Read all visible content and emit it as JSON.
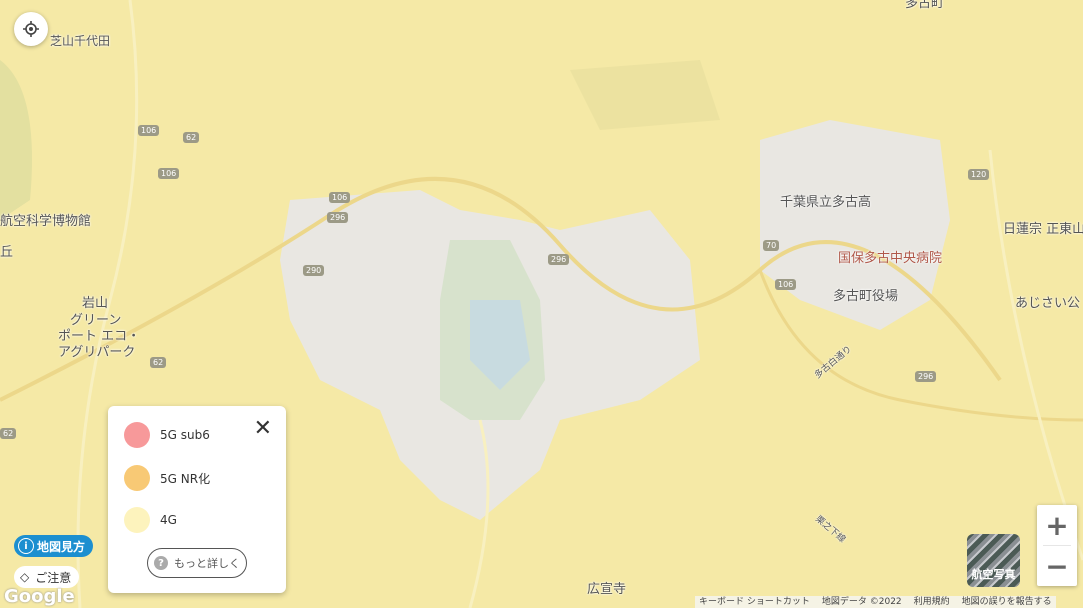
{
  "map": {
    "labels": {
      "top_town": "多古町",
      "shibayama": "芝山千代田",
      "museum": "航空科学博物館",
      "oka": "丘",
      "iwayama": "岩山",
      "green_port": "グリーン",
      "green_port2": "ポート エコ・",
      "green_port3": "アグリパーク",
      "high_school": "千葉県立多古高",
      "hospital": "国保多古中央病院",
      "town_office": "多古町役場",
      "temple_nichiren": "日蓮宗 正東山",
      "ajisai": "あじさい公",
      "kosenji": "広宣寺",
      "street_tako": "多古白通り",
      "street_kurinoshita": "栗之下線"
    },
    "shields": [
      "106",
      "62",
      "106",
      "106",
      "296",
      "290",
      "296",
      "70",
      "106",
      "120",
      "62",
      "296",
      "62"
    ]
  },
  "controls": {
    "locate_icon": "crosshair-icon"
  },
  "legend": {
    "items": [
      {
        "label": "5G sub6",
        "color": "#f7999a"
      },
      {
        "label": "5G NR化",
        "color": "#f8c975"
      },
      {
        "label": "4G",
        "color": "#fdf3bd"
      }
    ],
    "more_label": "もっと詳しく"
  },
  "buttons": {
    "map_guide": "地図見方",
    "caution": "ご注意",
    "aerial": "航空写真",
    "zoom_in": "+",
    "zoom_out": "−"
  },
  "google": "Google",
  "attribution": [
    "キーボード ショートカット",
    "地図データ ©2022",
    "利用規約",
    "地図の誤りを報告する"
  ]
}
